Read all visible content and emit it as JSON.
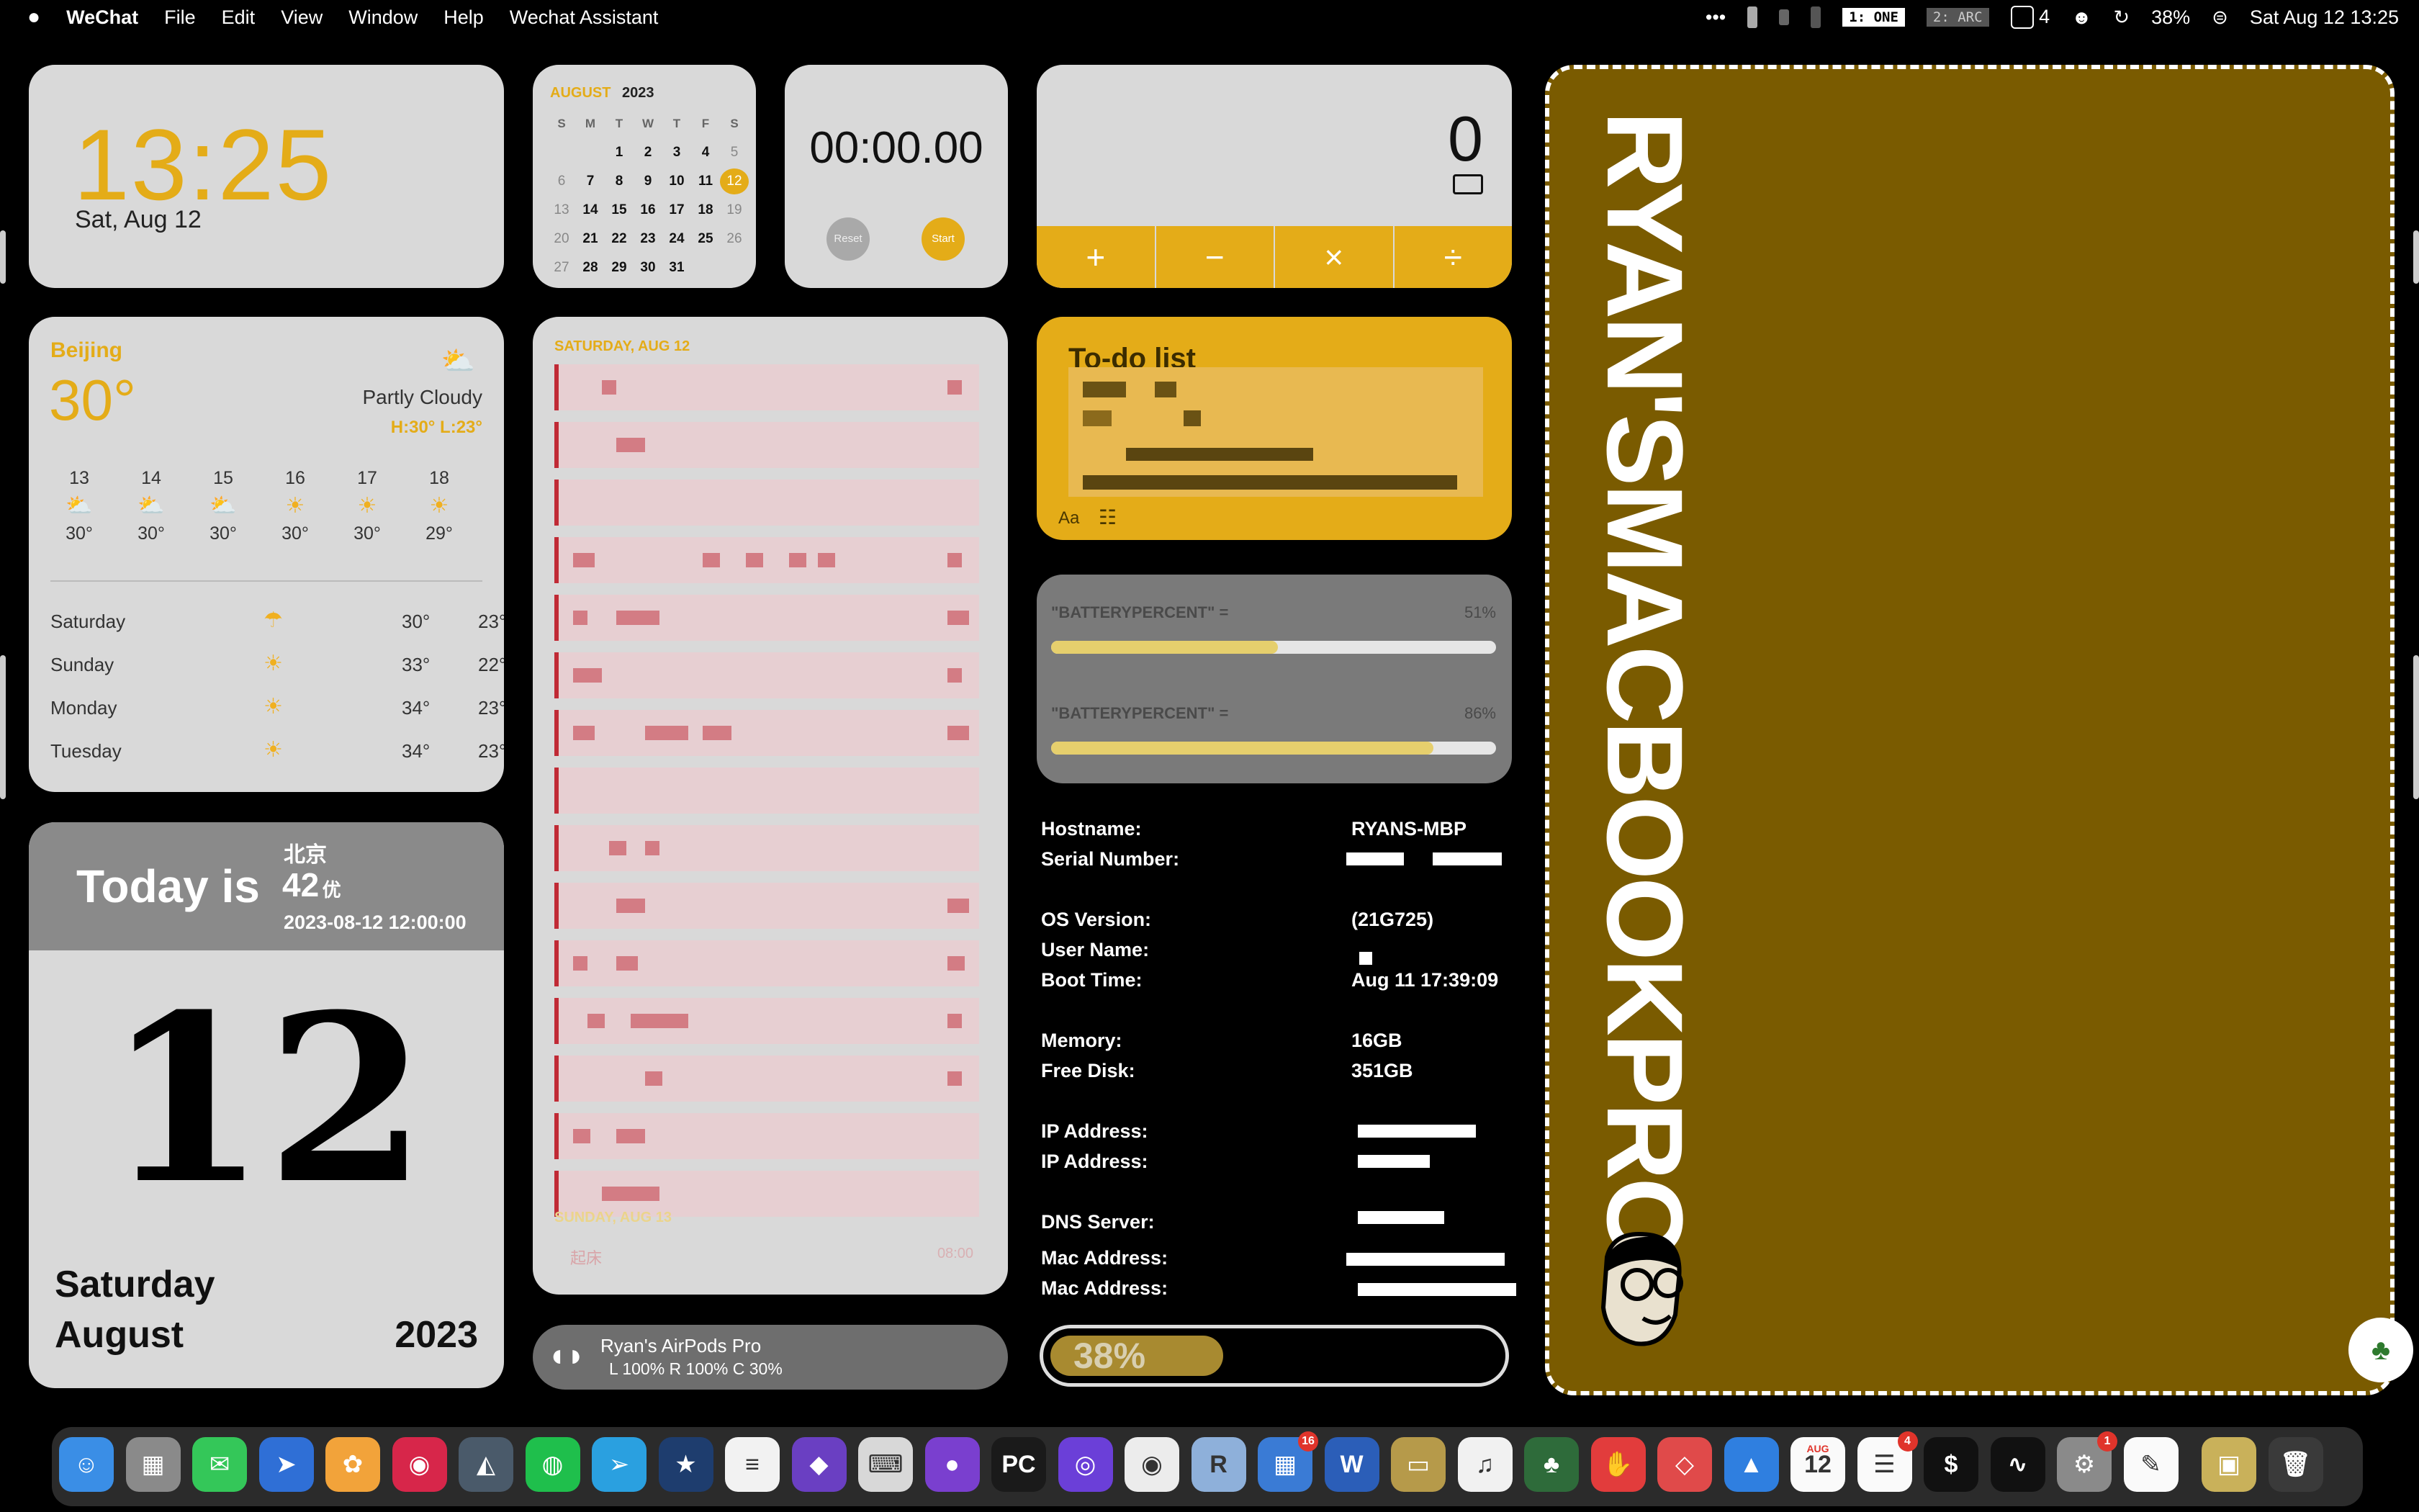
{
  "menubar": {
    "app_name": "WeChat",
    "menus": [
      "File",
      "Edit",
      "View",
      "Window",
      "Help",
      "Wechat Assistant"
    ],
    "overflow": "•••",
    "workspace_1": "1: ONE",
    "workspace_2": "2: ARC",
    "notif_count": "4",
    "battery": "38%",
    "datetime": "Sat Aug 12  13:25"
  },
  "clock": {
    "time": "13:25",
    "date": "Sat, Aug 12"
  },
  "calendar": {
    "month": "AUGUST",
    "year": "2023",
    "weekdays": [
      "S",
      "M",
      "T",
      "W",
      "T",
      "F",
      "S"
    ],
    "weeks": [
      [
        "",
        "",
        "1",
        "2",
        "3",
        "4",
        "5"
      ],
      [
        "6",
        "7",
        "8",
        "9",
        "10",
        "11",
        "12"
      ],
      [
        "13",
        "14",
        "15",
        "16",
        "17",
        "18",
        "19"
      ],
      [
        "20",
        "21",
        "22",
        "23",
        "24",
        "25",
        "26"
      ],
      [
        "27",
        "28",
        "29",
        "30",
        "31",
        "",
        ""
      ]
    ],
    "today": "12"
  },
  "stopwatch": {
    "time": "00:00.00",
    "reset_label": "Reset",
    "start_label": "Start"
  },
  "calculator": {
    "display": "0",
    "ops": [
      "+",
      "−",
      "×",
      "÷"
    ]
  },
  "weather": {
    "city": "Beijing",
    "temp": "30°",
    "condition": "Partly Cloudy",
    "hilo": "H:30°  L:23°",
    "hourly": [
      {
        "label": "13",
        "icon": "partly-cloudy",
        "temp": "30°"
      },
      {
        "label": "14",
        "icon": "partly-cloudy",
        "temp": "30°"
      },
      {
        "label": "15",
        "icon": "partly-cloudy",
        "temp": "30°"
      },
      {
        "label": "16",
        "icon": "sun",
        "temp": "30°"
      },
      {
        "label": "17",
        "icon": "sun",
        "temp": "30°"
      },
      {
        "label": "18",
        "icon": "sun",
        "temp": "29°"
      }
    ],
    "daily": [
      {
        "day": "Saturday",
        "icon": "rain",
        "hi": "30°",
        "lo": "23°"
      },
      {
        "day": "Sunday",
        "icon": "sun",
        "hi": "33°",
        "lo": "22°"
      },
      {
        "day": "Monday",
        "icon": "sun",
        "hi": "34°",
        "lo": "23°"
      },
      {
        "day": "Tuesday",
        "icon": "sun",
        "hi": "34°",
        "lo": "23°"
      }
    ]
  },
  "today": {
    "headline": "Today is",
    "city": "北京",
    "aqi": "42",
    "aqi_level": "优",
    "timestamp": "2023-08-12 12:00:00",
    "day_number": "12",
    "weekday": "Saturday",
    "month": "August",
    "year": "2023"
  },
  "agenda": {
    "header": "SATURDAY, AUG 12",
    "next_header": "SUNDAY, AUG 13",
    "next_event": "起床",
    "next_time": "08:00"
  },
  "todo": {
    "title": "To-do list",
    "font_label": "Aa"
  },
  "battery_widget": {
    "rows": [
      {
        "label": "\"BATTERYPERCENT\" =",
        "pct_text": "51%",
        "fill": 0.51
      },
      {
        "label": "\"BATTERYPERCENT\" =",
        "pct_text": "86%",
        "fill": 0.86
      }
    ]
  },
  "sysinfo": {
    "hostname_label": "Hostname:",
    "hostname": "RYANS-MBP",
    "serial_label": "Serial Number:",
    "os_label": "OS Version:",
    "os": "(21G725)",
    "user_label": "User Name:",
    "boot_label": "Boot Time:",
    "boot": "Aug 11 17:39:09",
    "memory_label": "Memory:",
    "memory": "16GB",
    "disk_label": "Free Disk:",
    "disk": "351GB",
    "ip_label_1": "IP Address:",
    "ip_label_2": "IP Address:",
    "dns_label": "DNS Server:",
    "mac_label_1": "Mac Address:",
    "mac_label_2": "Mac Address:"
  },
  "airpods": {
    "name": "Ryan's AirPods Pro",
    "levels": "L 100%   R 100%   C 30%"
  },
  "bottom_battery": {
    "text": "38%",
    "fill": 0.38
  },
  "poster": {
    "title": "RYAN'SMACBOOKPRO"
  },
  "dock": {
    "apps": [
      {
        "name": "finder",
        "glyph": "☺",
        "color": "#3a8ee6"
      },
      {
        "name": "launchpad",
        "glyph": "▦",
        "color": "#8a8a8a"
      },
      {
        "name": "messages",
        "glyph": "✉",
        "color": "#34c759"
      },
      {
        "name": "spark",
        "glyph": "➤",
        "color": "#2f6fd6"
      },
      {
        "name": "photos",
        "glyph": "✿",
        "color": "#f2a33a"
      },
      {
        "name": "music-player",
        "glyph": "◉",
        "color": "#d7264a"
      },
      {
        "name": "affinity-designer",
        "glyph": "◭",
        "color": "#4a5a6a"
      },
      {
        "name": "wechat",
        "glyph": "◍",
        "color": "#1fbf4c"
      },
      {
        "name": "telegram",
        "glyph": "➢",
        "color": "#2aa0e0"
      },
      {
        "name": "star-app",
        "glyph": "★",
        "color": "#1e3d6e"
      },
      {
        "name": "notes-list",
        "glyph": "≡",
        "color": "#f2f2f2"
      },
      {
        "name": "obsidian",
        "glyph": "◆",
        "color": "#6a3fc2"
      },
      {
        "name": "keyboard-app",
        "glyph": "⌨",
        "color": "#d8d8d8"
      },
      {
        "name": "github",
        "glyph": "●",
        "color": "#7a3fcf"
      },
      {
        "name": "pycharm",
        "glyph": "PC",
        "color": "#1a1a1a"
      },
      {
        "name": "camo",
        "glyph": "◎",
        "color": "#6b3fd8"
      },
      {
        "name": "chrome",
        "glyph": "◉",
        "color": "#ececec"
      },
      {
        "name": "r-app",
        "glyph": "R",
        "color": "#8eb0da"
      },
      {
        "name": "grid-app",
        "glyph": "▦",
        "color": "#3a7bd5"
      },
      {
        "name": "word",
        "glyph": "W",
        "color": "#2b5eb8"
      },
      {
        "name": "terminal-retro",
        "glyph": "▭",
        "color": "#b69a4a"
      },
      {
        "name": "music",
        "glyph": "♫",
        "color": "#f1f1f1"
      },
      {
        "name": "bonsai",
        "glyph": "♣",
        "color": "#2e6b3a"
      },
      {
        "name": "thumb-app",
        "glyph": "✋",
        "color": "#e23c3c"
      },
      {
        "name": "gem-app",
        "glyph": "◇",
        "color": "#e04a4a"
      },
      {
        "name": "mountain-app",
        "glyph": "▲",
        "color": "#2f7fe0"
      },
      {
        "name": "calendar",
        "glyph": "12",
        "color": "#fafafa"
      },
      {
        "name": "reminders",
        "glyph": "☰",
        "color": "#fafafa"
      },
      {
        "name": "terminal",
        "glyph": "$",
        "color": "#111111"
      },
      {
        "name": "activity-monitor",
        "glyph": "∿",
        "color": "#111111"
      },
      {
        "name": "system-settings",
        "glyph": "⚙",
        "color": "#8a8a8a"
      },
      {
        "name": "textedit",
        "glyph": "✎",
        "color": "#fafafa"
      },
      {
        "name": "image-viewer",
        "glyph": "▣",
        "color": "#c9b15a"
      },
      {
        "name": "trash",
        "glyph": "🗑",
        "color": "#3a3a3a"
      }
    ],
    "badge_grid": "16",
    "badge_reminders": "4",
    "badge_settings": "1",
    "calendar_month": "AUG"
  }
}
